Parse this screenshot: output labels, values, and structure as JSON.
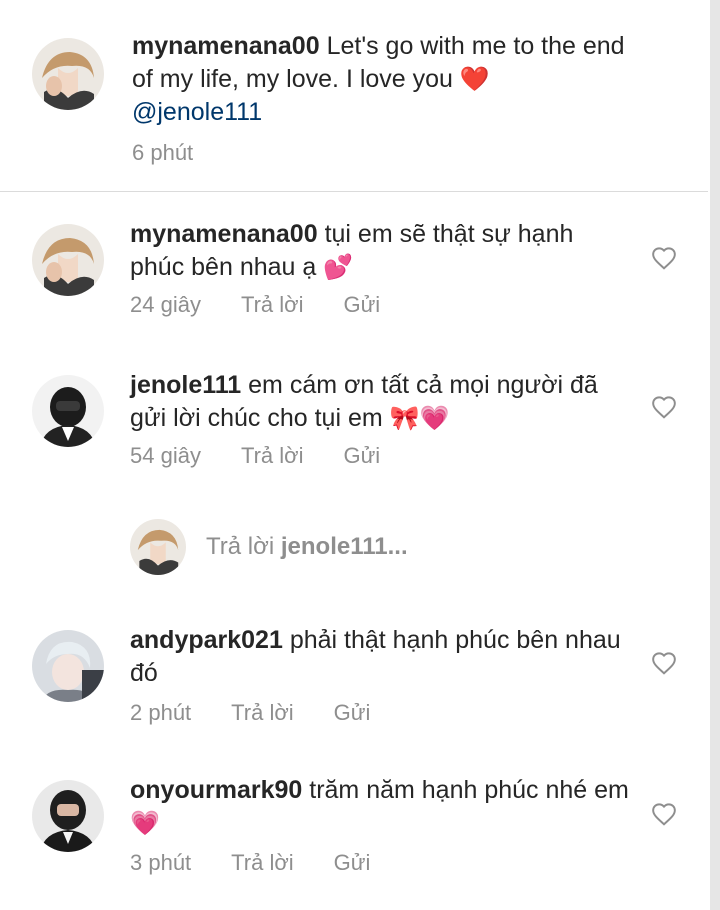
{
  "caption": {
    "username": "mynamenana00",
    "text": "Let's go with me to the end of my life, my love. I love you",
    "emoji": "❤️",
    "mention": "@jenole111",
    "time": "6 phút"
  },
  "comments": [
    {
      "username": "mynamenana00",
      "text": "tụi em sẽ thật sự hạnh phúc bên nhau ạ",
      "emoji": "💕",
      "time": "24 giây",
      "reply_label": "Trả lời",
      "send_label": "Gửi"
    },
    {
      "username": "jenole111",
      "text": "em cám ơn tất cả mọi người đã gửi lời chúc cho tụi em",
      "emoji": "🎀💗",
      "time": "54 giây",
      "reply_label": "Trả lời",
      "send_label": "Gửi"
    },
    {
      "username": "andypark021",
      "text": "phải thật hạnh phúc bên nhau đó",
      "emoji": "",
      "time": "2 phút",
      "reply_label": "Trả lời",
      "send_label": "Gửi"
    },
    {
      "username": "onyourmark90",
      "text": "trăm năm hạnh phúc nhé em",
      "emoji": "💗",
      "time": "3 phút",
      "reply_label": "Trả lời",
      "send_label": "Gửi"
    }
  ],
  "reply_input": {
    "prefix": "Trả lời",
    "target": "jenole111..."
  },
  "colors": {
    "text": "#262626",
    "secondary": "#8e8e8e",
    "mention": "#00376b",
    "divider": "#dbdbdb"
  },
  "icons": [
    "heart-icon"
  ]
}
